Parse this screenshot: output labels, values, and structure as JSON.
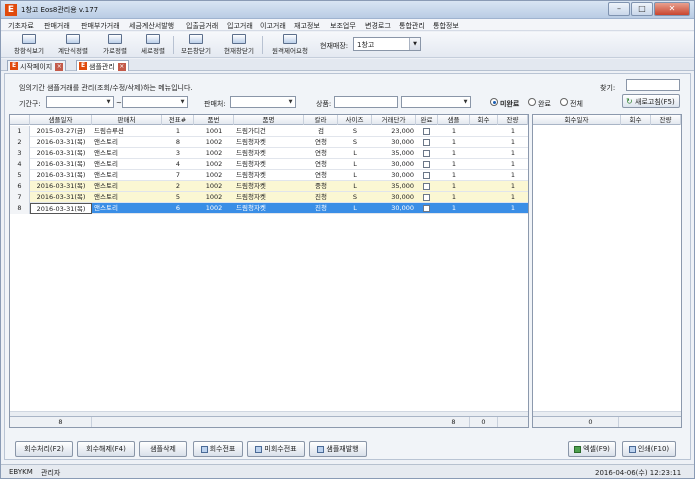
{
  "window": {
    "title": "1창고 Eos8관리용 v.177",
    "app_icon_letter": "E"
  },
  "menu": [
    "기초자료",
    "판매거래",
    "판매부가거래",
    "세금계산서발행",
    "입출금거래",
    "입고거래",
    "이고거래",
    "재고정보",
    "보조업무",
    "변경로그",
    "통합관리",
    "통합정보"
  ],
  "toolbar": {
    "buttons": [
      "창항식보기",
      "계단식정렬",
      "가로정렬",
      "세로정렬",
      "모든창닫기",
      "현재창닫기",
      "원격제어요청"
    ],
    "store_label": "현재매장:",
    "store_value": "1창고"
  },
  "tabs": [
    {
      "label": "시작페이지"
    },
    {
      "label": "샘플관리"
    }
  ],
  "filters": {
    "info": "임의기간 샘플거래를 관리(조회/수정/삭제)하는 메뉴입니다.",
    "find_label": "찾기:",
    "period_label": "기간구:",
    "range_sep": "~",
    "seller_label": "판매처:",
    "product_label": "상품:",
    "radio_options": [
      "미완료",
      "완료",
      "전체"
    ],
    "refresh_label": "새로고침(F5)"
  },
  "grid": {
    "columns": [
      "샘플일자",
      "판매처",
      "전표#",
      "품번",
      "품명",
      "칼라",
      "사이즈",
      "거래단가",
      "완료",
      "샘플",
      "회수",
      "잔량"
    ],
    "rows": [
      {
        "num": "1",
        "date": "2015-03-27(금)",
        "seller": "드림슈루션",
        "slip": "1",
        "code": "1001",
        "name": "드림가디건",
        "color": "검",
        "size": "S",
        "price": "23,000",
        "sample": "1",
        "ret": "",
        "remain": "1",
        "style": ""
      },
      {
        "num": "2",
        "date": "2016-03-31(목)",
        "seller": "앤스토리",
        "slip": "8",
        "code": "1002",
        "name": "드림청자켓",
        "color": "연청",
        "size": "S",
        "price": "30,000",
        "sample": "1",
        "ret": "",
        "remain": "1",
        "style": ""
      },
      {
        "num": "3",
        "date": "2016-03-31(목)",
        "seller": "앤스토리",
        "slip": "3",
        "code": "1002",
        "name": "드림청자켓",
        "color": "연청",
        "size": "L",
        "price": "35,000",
        "sample": "1",
        "ret": "",
        "remain": "1",
        "style": ""
      },
      {
        "num": "4",
        "date": "2016-03-31(목)",
        "seller": "앤스토리",
        "slip": "4",
        "code": "1002",
        "name": "드림청자켓",
        "color": "연청",
        "size": "L",
        "price": "30,000",
        "sample": "1",
        "ret": "",
        "remain": "1",
        "style": ""
      },
      {
        "num": "5",
        "date": "2016-03-31(목)",
        "seller": "앤스토리",
        "slip": "7",
        "code": "1002",
        "name": "드림청자켓",
        "color": "연청",
        "size": "L",
        "price": "30,000",
        "sample": "1",
        "ret": "",
        "remain": "1",
        "style": ""
      },
      {
        "num": "6",
        "date": "2016-03-31(목)",
        "seller": "앤스토리",
        "slip": "2",
        "code": "1002",
        "name": "드림청자켓",
        "color": "중청",
        "size": "L",
        "price": "35,000",
        "sample": "1",
        "ret": "",
        "remain": "1",
        "style": "hl"
      },
      {
        "num": "7",
        "date": "2016-03-31(목)",
        "seller": "앤스토리",
        "slip": "5",
        "code": "1002",
        "name": "드림청자켓",
        "color": "진청",
        "size": "S",
        "price": "30,000",
        "sample": "1",
        "ret": "",
        "remain": "1",
        "style": "hl"
      },
      {
        "num": "8",
        "date": "2016-03-31(목)",
        "seller": "앤스토리",
        "slip": "6",
        "code": "1002",
        "name": "드림청자켓",
        "color": "진청",
        "size": "L",
        "price": "30,000",
        "sample": "1",
        "ret": "",
        "remain": "1",
        "style": "sel"
      }
    ],
    "footer": {
      "count": "8",
      "sample_total": "8",
      "return_total": "0"
    }
  },
  "side_grid": {
    "columns": [
      "회수일자",
      "회수",
      "잔량"
    ],
    "footer_count": "0"
  },
  "bottom_buttons": {
    "left": [
      "회수처리(F2)",
      "회수해제(F4)",
      "샘플삭제",
      "회수전표",
      "미회수전표",
      "샘플재발행"
    ],
    "excel": "엑셀(F9)",
    "print": "인쇄(F10)"
  },
  "status": {
    "user_id": "EBYKM",
    "user_role": "관리자",
    "datetime": "2016-04-06(수) 12:23:11"
  },
  "colors": {
    "selected_row": "#3a8ee6",
    "highlight_row": "#fbf7d3",
    "brand": "#e04a0c"
  }
}
